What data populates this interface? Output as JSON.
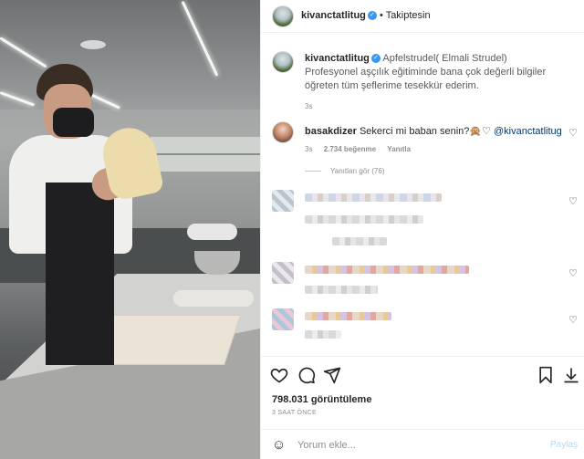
{
  "header": {
    "username": "kivanctatlitug",
    "separator": "•",
    "follow_status": "Takiptesin"
  },
  "caption": {
    "username": "kivanctatlitug",
    "text": "Apfelstrudel( Elmali Strudel)",
    "text2": "Profesyonel aşçılık eğitiminde bana çok değerli bilgiler öğreten tüm şeflerime tesekkür ederim.",
    "time": "3s"
  },
  "comment": {
    "username": "basakdizer",
    "text": "Sekerci mi baban senin?🙊♡",
    "mention": "@kivanctatlitug",
    "time": "3s",
    "likes": "2.734 beğenme",
    "reply": "Yanıtla",
    "view_replies": "Yanıtları gör (76)"
  },
  "stats": {
    "views": "798.031 görüntüleme",
    "posted_ago": "3 SAAT ÖNCE"
  },
  "composer": {
    "placeholder": "Yorum ekle...",
    "post_label": "Paylaş"
  },
  "icons": {
    "like": "heart-icon",
    "comment": "comment-icon",
    "share": "send-icon",
    "save": "bookmark-icon",
    "download": "download-icon",
    "emoji": "smiley-icon"
  },
  "colors": {
    "link": "#00376b",
    "verified": "#3897f0",
    "muted": "#8e8e8e"
  }
}
